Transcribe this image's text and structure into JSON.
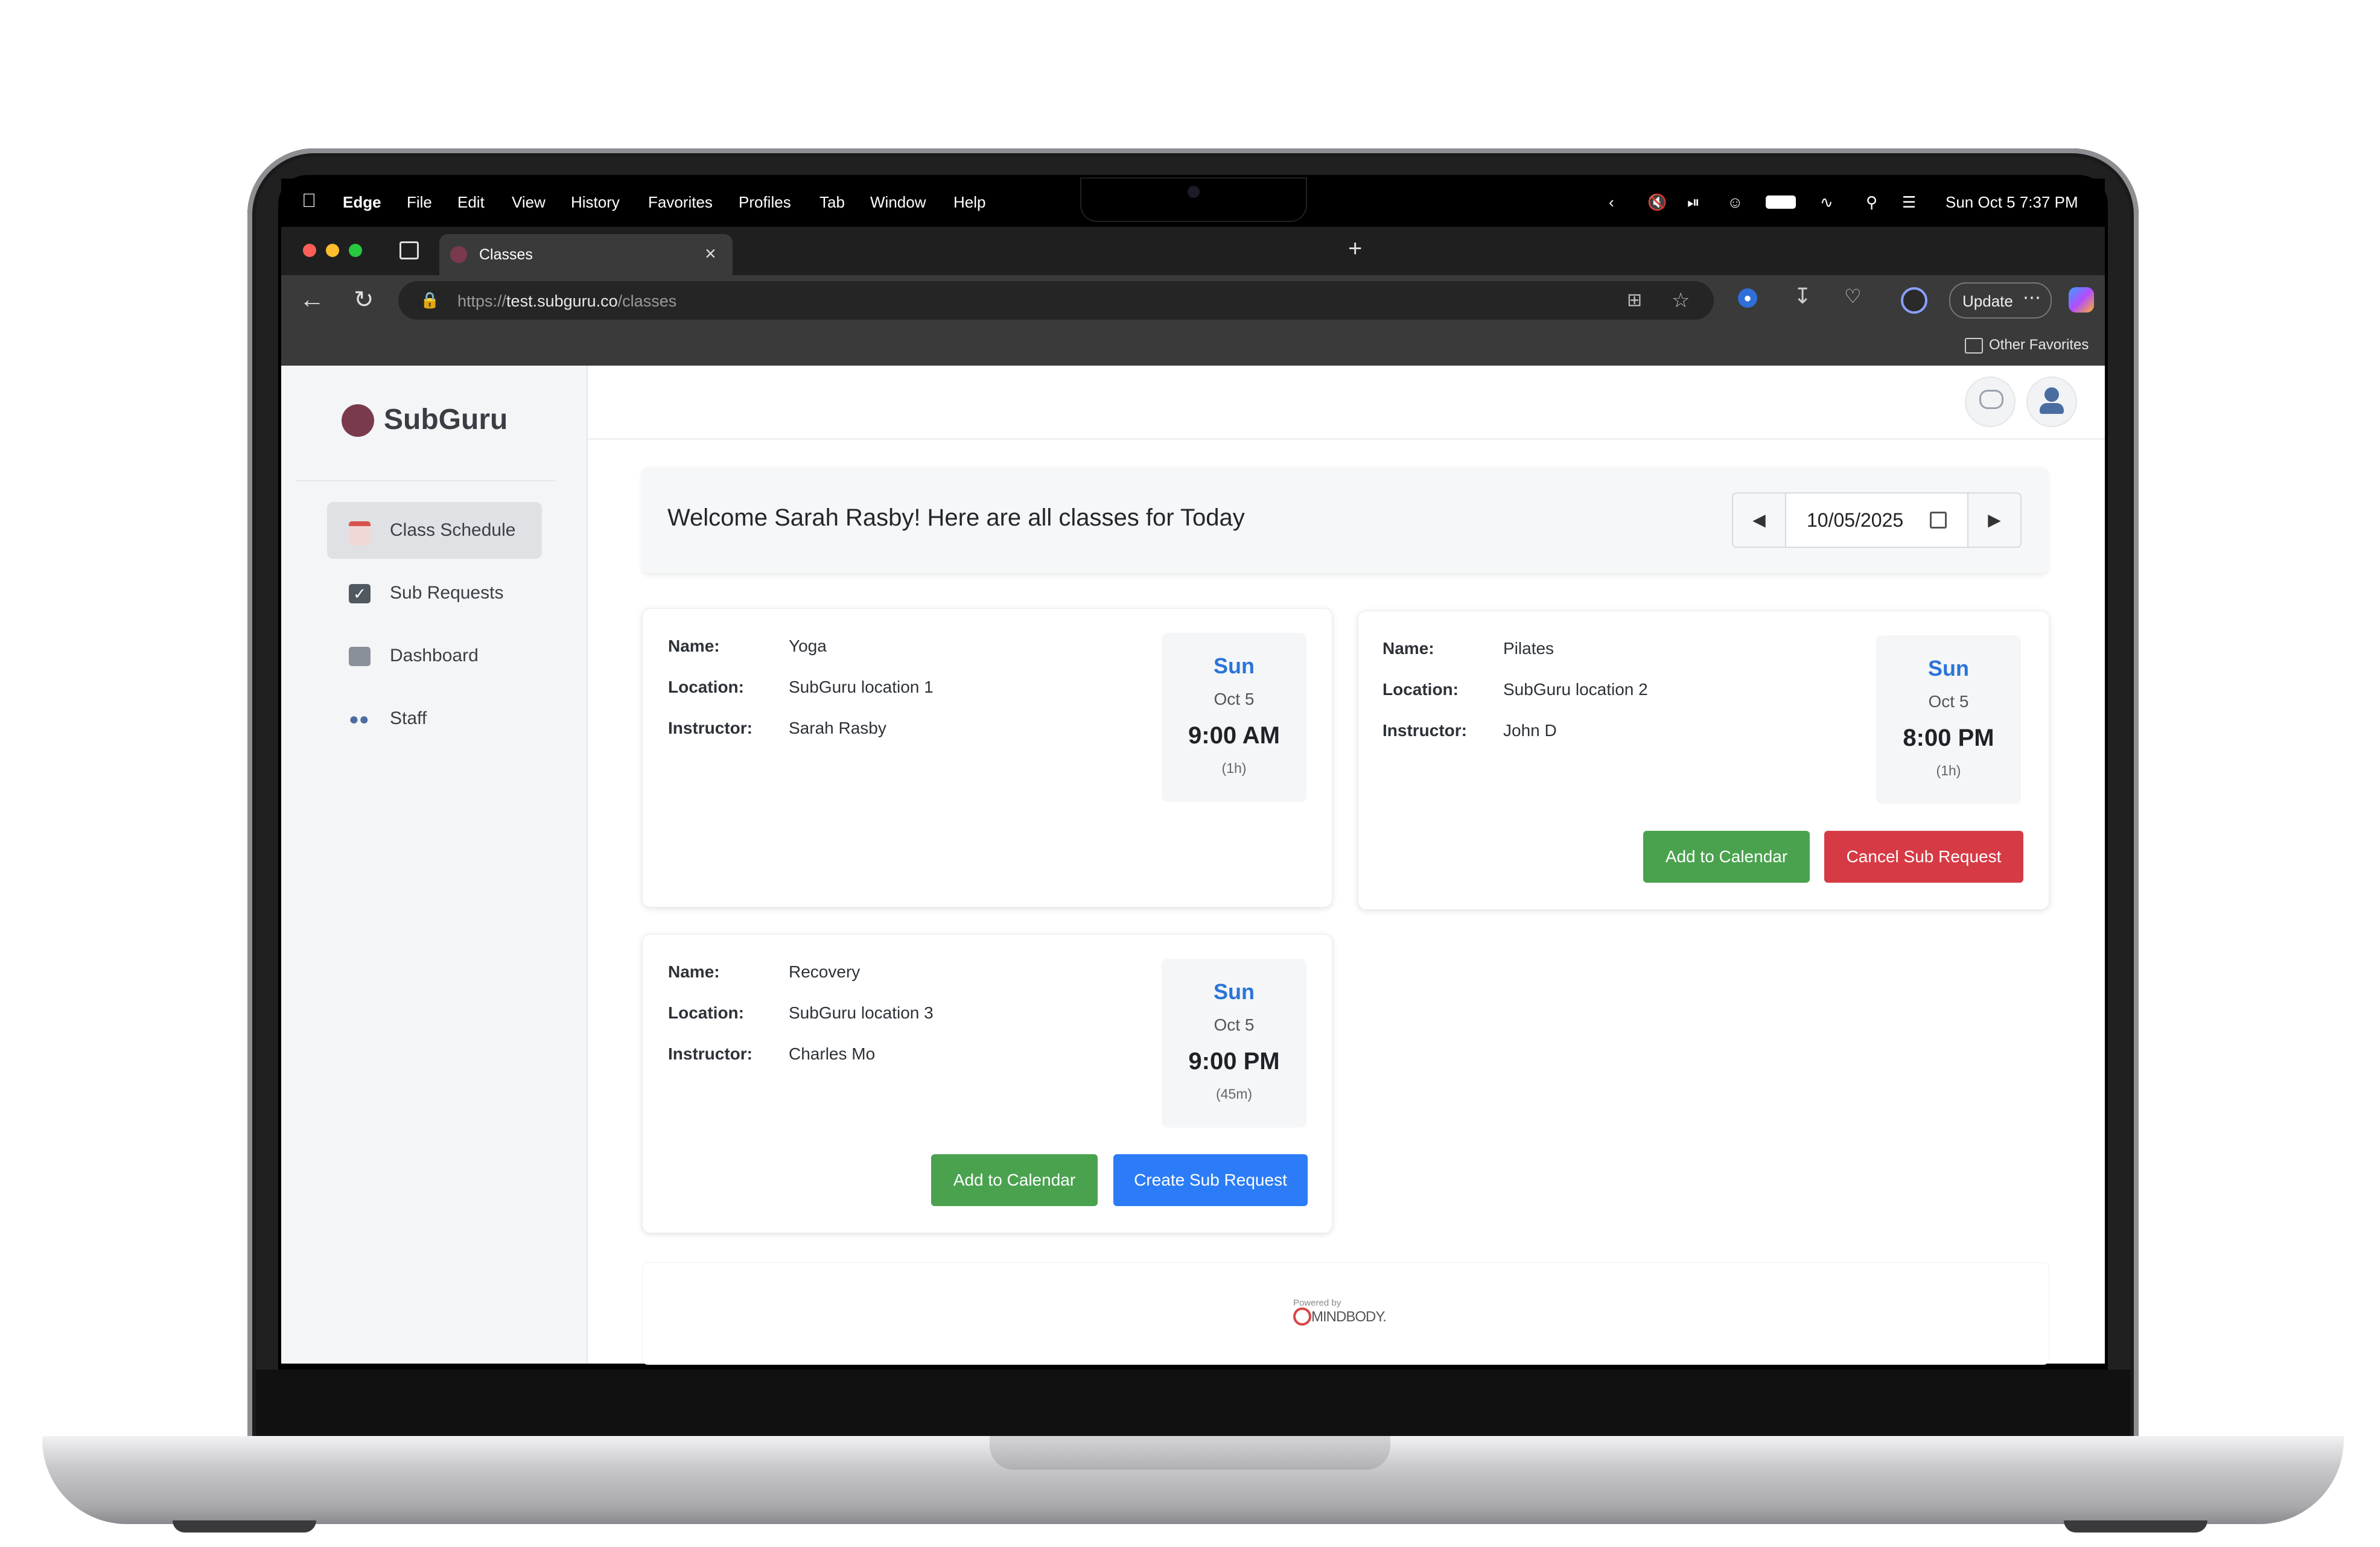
{
  "menubar": {
    "app": "Edge",
    "menus": [
      "File",
      "Edit",
      "View",
      "History",
      "Favorites",
      "Profiles",
      "Tab",
      "Window",
      "Help"
    ],
    "clock": "Sun Oct 5  7:37 PM"
  },
  "browser": {
    "tab_title": "Classes",
    "url_prefix": "https://",
    "url_host": "test.subguru.co",
    "url_path": "/classes",
    "update_label": "Update",
    "other_favorites": "Other Favorites"
  },
  "sidebar": {
    "brand": "SubGuru",
    "items": [
      {
        "label": "Class Schedule",
        "icon": "calendar-icon"
      },
      {
        "label": "Sub Requests",
        "icon": "checkbox-icon"
      },
      {
        "label": "Dashboard",
        "icon": "building-icon"
      },
      {
        "label": "Staff",
        "icon": "people-icon"
      }
    ]
  },
  "header": {
    "welcome": "Welcome Sarah Rasby! Here are all classes for Today",
    "date": "10/05/2025"
  },
  "labels": {
    "name": "Name:",
    "location": "Location:",
    "instructor": "Instructor:"
  },
  "classes": [
    {
      "name": "Yoga",
      "location": "SubGuru location 1",
      "instructor": "Sarah Rasby",
      "dow": "Sun",
      "date": "Oct 5",
      "time": "9:00 AM",
      "duration": "(1h)"
    },
    {
      "name": "Pilates",
      "location": "SubGuru location 2",
      "instructor": "John D",
      "dow": "Sun",
      "date": "Oct 5",
      "time": "8:00 PM",
      "duration": "(1h)",
      "btn1": "Add to Calendar",
      "btn2": "Cancel Sub Request"
    },
    {
      "name": "Recovery",
      "location": "SubGuru location 3",
      "instructor": "Charles Mo",
      "dow": "Sun",
      "date": "Oct 5",
      "time": "9:00 PM",
      "duration": "(45m)",
      "btn1": "Add to Calendar",
      "btn2": "Create Sub Request"
    }
  ],
  "footer": {
    "powered_by": "Powered by",
    "brand": "MINDBODY."
  },
  "colors": {
    "accent_blue": "#2b7cf6",
    "green": "#4aa24f",
    "red": "#d63b45",
    "brand_dot": "#7a3a4e"
  }
}
